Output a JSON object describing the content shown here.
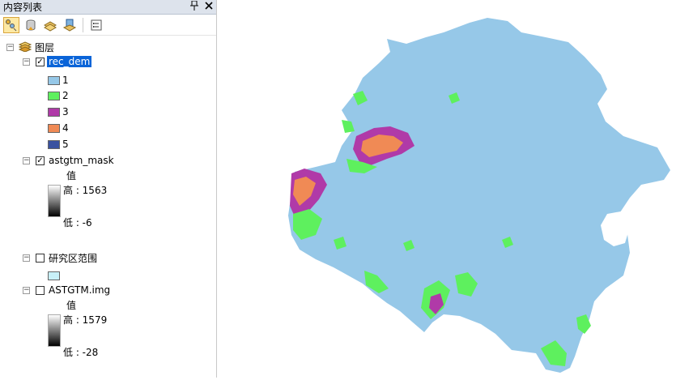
{
  "toc": {
    "title": "内容列表",
    "pin": "📌",
    "close": "✕",
    "group_label": "图层",
    "layers": [
      {
        "name": "rec_dem",
        "checked": true,
        "classes": [
          {
            "label": "1",
            "color": "#96c8e8"
          },
          {
            "label": "2",
            "color": "#5ef05e"
          },
          {
            "label": "3",
            "color": "#b03aa8"
          },
          {
            "label": "4",
            "color": "#f08a55"
          },
          {
            "label": "5",
            "color": "#3a52a0"
          }
        ]
      },
      {
        "name": "astgtm_mask",
        "checked": true,
        "value_title": "值",
        "high": "高 : 1563",
        "low": "低 : -6"
      },
      {
        "name": "研究区范围",
        "checked": false,
        "fill": "#c8f0f8"
      },
      {
        "name": "ASTGTM.img",
        "checked": false,
        "value_title": "值",
        "high": "高 : 1579",
        "low": "低 : -28"
      }
    ]
  },
  "colors": {
    "base": "#96c8e8",
    "c2": "#5ef05e",
    "c3": "#b03aa8",
    "c4": "#f08a55",
    "selection": "#0a64d8"
  },
  "icons": [
    "list-by-drawing-order-icon",
    "list-by-source-icon",
    "list-by-visibility-icon",
    "list-by-selection-icon",
    "options-icon"
  ]
}
